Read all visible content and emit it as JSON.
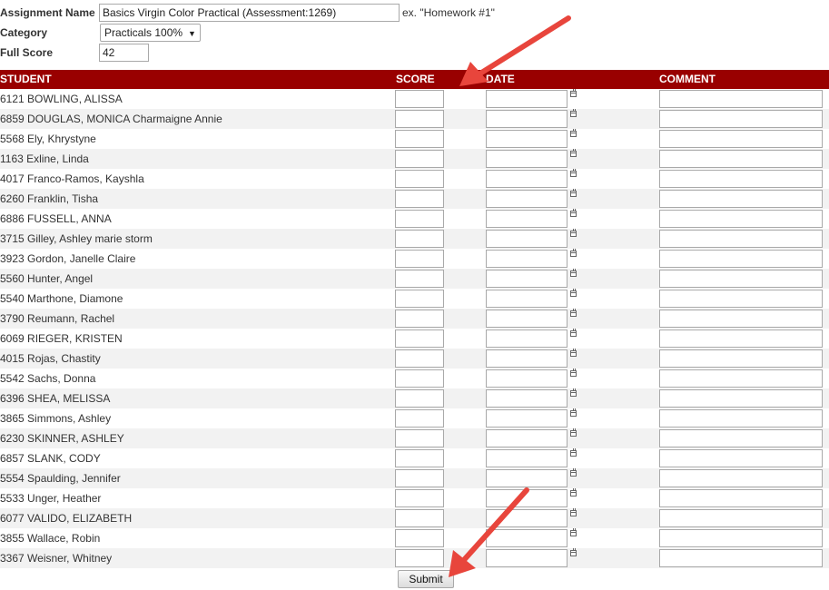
{
  "form": {
    "assignment_name_label": "Assignment Name",
    "assignment_name_value": "Basics Virgin Color Practical (Assessment:1269)",
    "assignment_name_hint": "ex. \"Homework #1\"",
    "category_label": "Category",
    "category_selected": "Practicals 100%",
    "full_score_label": "Full Score",
    "full_score_value": "42"
  },
  "table": {
    "headers": {
      "student": "STUDENT",
      "score": "SCORE",
      "date": "DATE",
      "comment": "COMMENT"
    },
    "students": [
      "6121 BOWLING, ALISSA",
      "6859 DOUGLAS, MONICA Charmaigne Annie",
      "5568 Ely, Khrystyne",
      "1163 Exline, Linda",
      "4017 Franco-Ramos, Kayshla",
      "6260 Franklin, Tisha",
      "6886 FUSSELL, ANNA",
      "3715 Gilley, Ashley marie storm",
      "3923 Gordon, Janelle Claire",
      "5560 Hunter, Angel",
      "5540 Marthone, Diamone",
      "3790 Reumann, Rachel",
      "6069 RIEGER, KRISTEN",
      "4015 Rojas, Chastity",
      "5542 Sachs, Donna",
      "6396 SHEA, MELISSA",
      "3865 Simmons, Ashley",
      "6230 SKINNER, ASHLEY",
      "6857 SLANK, CODY",
      "5554 Spaulding, Jennifer",
      "5533 Unger, Heather",
      "6077 VALIDO, ELIZABETH",
      "3855 Wallace, Robin",
      "3367 Weisner, Whitney"
    ]
  },
  "submit_label": "Submit",
  "colors": {
    "header_bg": "#990000",
    "alt_row": "#f2f2f2",
    "annotation_arrow": "#e8453c"
  },
  "icons": {
    "date_picker": "calendar-icon",
    "annotation": "arrow-icon"
  }
}
